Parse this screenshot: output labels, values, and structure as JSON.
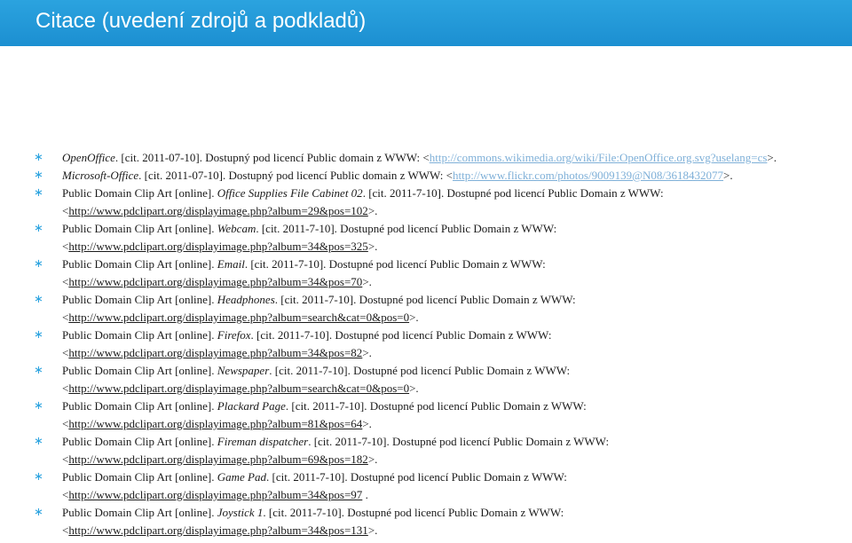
{
  "title": "Citace (uvedení zdrojů a podkladů)",
  "references": [
    {
      "prefix": "",
      "work": "OpenOffice",
      "mid": ". [cit. 2011-07-10]. Dostupný pod licencí Public domain z WWW: <",
      "url": "http://commons.wikimedia.org/wiki/File:OpenOffice.org.svg?uselang=cs",
      "suffix": ">."
    },
    {
      "prefix": "",
      "work": "Microsoft-Office",
      "mid": ". [cit. 2011-07-10]. Dostupný pod licencí Public domain z WWW: <",
      "url": "http://www.flickr.com/photos/9009139@N08/3618432077",
      "suffix": ">."
    },
    {
      "prefix": "Public Domain Clip Art [online]. ",
      "work": "Office Supplies File Cabinet 02",
      "mid": ". [cit. 2011-7-10]. Dostupné pod licencí Public Domain z WWW:",
      "url": "http://www.pdclipart.org/displayimage.php?album=29&pos=102",
      "suffix": ">."
    },
    {
      "prefix": "Public Domain Clip Art [online]. ",
      "work": "Webcam",
      "mid": ". [cit. 2011-7-10]. Dostupné pod licencí Public Domain z WWW:",
      "url": "http://www.pdclipart.org/displayimage.php?album=34&pos=325",
      "suffix": ">."
    },
    {
      "prefix": "Public Domain Clip Art [online]. ",
      "work": "Email",
      "mid": ". [cit. 2011-7-10]. Dostupné pod licencí Public Domain z WWW:",
      "url": "http://www.pdclipart.org/displayimage.php?album=34&pos=70",
      "suffix": ">."
    },
    {
      "prefix": "Public Domain Clip Art [online]. ",
      "work": "Headphones",
      "mid": ". [cit. 2011-7-10]. Dostupné pod licencí Public Domain z WWW:",
      "url": "http://www.pdclipart.org/displayimage.php?album=search&cat=0&pos=0",
      "suffix": ">."
    },
    {
      "prefix": "Public Domain Clip Art [online]. ",
      "work": "Firefox",
      "mid": ". [cit. 2011-7-10]. Dostupné pod licencí Public Domain z WWW:",
      "url": "http://www.pdclipart.org/displayimage.php?album=34&pos=82",
      "suffix": ">."
    },
    {
      "prefix": "Public Domain Clip Art [online]. ",
      "work": "Newspaper",
      "mid": ". [cit. 2011-7-10]. Dostupné pod licencí Public Domain z WWW:",
      "url": "http://www.pdclipart.org/displayimage.php?album=search&cat=0&pos=0",
      "suffix": ">."
    },
    {
      "prefix": "Public Domain Clip Art [online]. ",
      "work": "Plackard Page",
      "mid": ". [cit. 2011-7-10]. Dostupné pod licencí Public Domain z WWW:",
      "url": "http://www.pdclipart.org/displayimage.php?album=81&pos=64",
      "suffix": ">."
    },
    {
      "prefix": "Public Domain Clip Art [online]. ",
      "work": "Fireman dispatcher",
      "mid": ". [cit. 2011-7-10]. Dostupné pod licencí Public Domain z WWW:",
      "url": "http://www.pdclipart.org/displayimage.php?album=69&pos=182",
      "suffix": ">."
    },
    {
      "prefix": "Public Domain Clip Art [online]. ",
      "work": "Game Pad",
      "mid": ". [cit. 2011-7-10]. Dostupné pod licencí Public Domain z WWW:",
      "url": "http://www.pdclipart.org/displayimage.php?album=34&pos=97",
      "suffix": " ."
    },
    {
      "prefix": "Public Domain Clip Art [online]. ",
      "work": "Joystick 1",
      "mid": ". [cit. 2011-7-10]. Dostupné pod licencí Public Domain z WWW:",
      "url": "http://www.pdclipart.org/displayimage.php?album=34&pos=131",
      "suffix": ">."
    }
  ]
}
